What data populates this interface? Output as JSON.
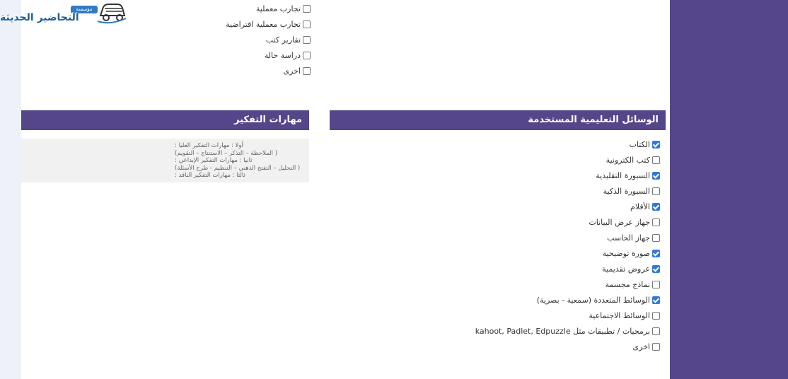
{
  "logo": {
    "badge": "مؤسسة",
    "name": "التحاضير الحديثة"
  },
  "activities": {
    "items": [
      {
        "label": "تجارب معملية",
        "checked": false
      },
      {
        "label": "تجارب معملية افتراضية",
        "checked": false
      },
      {
        "label": "تقارير كتب",
        "checked": false
      },
      {
        "label": "دراسة حالة",
        "checked": false
      },
      {
        "label": "اخرى",
        "checked": false
      }
    ]
  },
  "thinking": {
    "title": "مهارات التفكير",
    "lines": [
      "أولا : مهارات التفكير العليا :",
      "( الملاحظة – التذكر – الاستنتاج – التقويم)",
      "ثانيا : مهارات التفكير الإبداعي :",
      "( التحليل – التفتح الذهني – التنظيم - طرح الأسئلة)",
      "ثالثا : مهارات التفكير الناقد :"
    ]
  },
  "media": {
    "title": "الوسائل التعليمية المستخدمة",
    "items": [
      {
        "label": "الكتاب",
        "checked": true
      },
      {
        "label": "كتب الكترونية",
        "checked": false
      },
      {
        "label": "السبورة التقليدية",
        "checked": true
      },
      {
        "label": "السبورة الذكية",
        "checked": false
      },
      {
        "label": "الأقلام",
        "checked": true
      },
      {
        "label": "جهاز عرض البيانات",
        "checked": false
      },
      {
        "label": "جهاز الحاسب",
        "checked": false
      },
      {
        "label": "صورة توضيحية",
        "checked": true
      },
      {
        "label": "عروض تقديمية",
        "checked": true
      },
      {
        "label": "نماذج مجسمة",
        "checked": false
      },
      {
        "label": "الوسائط المتعددة (سمعية - بصرية)",
        "checked": true
      },
      {
        "label": "الوسائط الاجتماعية",
        "checked": false
      },
      {
        "label": "برمجيات / تطبيقات مثل kahoot, Padlet, Edpuzzle",
        "checked": false
      },
      {
        "label": "اخرى",
        "checked": false
      }
    ]
  },
  "colors": {
    "accent": "#55468a",
    "checkbox": "#2f7ad9"
  }
}
